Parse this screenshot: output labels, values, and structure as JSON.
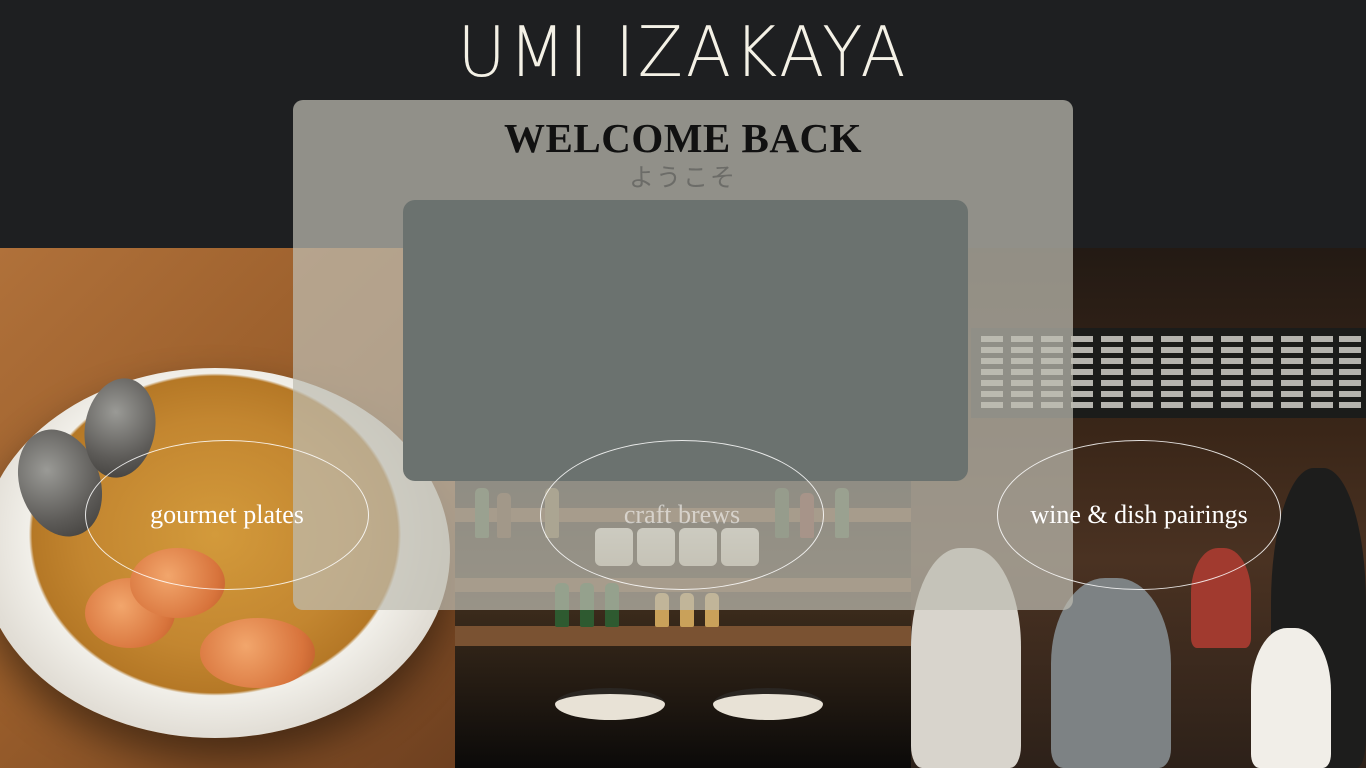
{
  "brand": {
    "name": "UMI IZAKAYA"
  },
  "welcome": {
    "title": "WELCOME BACK",
    "subtitle": "ようこそ"
  },
  "categories": [
    {
      "label": "gourmet plates"
    },
    {
      "label": "craft brews"
    },
    {
      "label": "wine & dish pairings"
    }
  ],
  "colors": {
    "background": "#1e1f21",
    "brand_text": "#f4f1e6",
    "overlay_card": "#bebcb2",
    "login_box": "#6b726f"
  }
}
